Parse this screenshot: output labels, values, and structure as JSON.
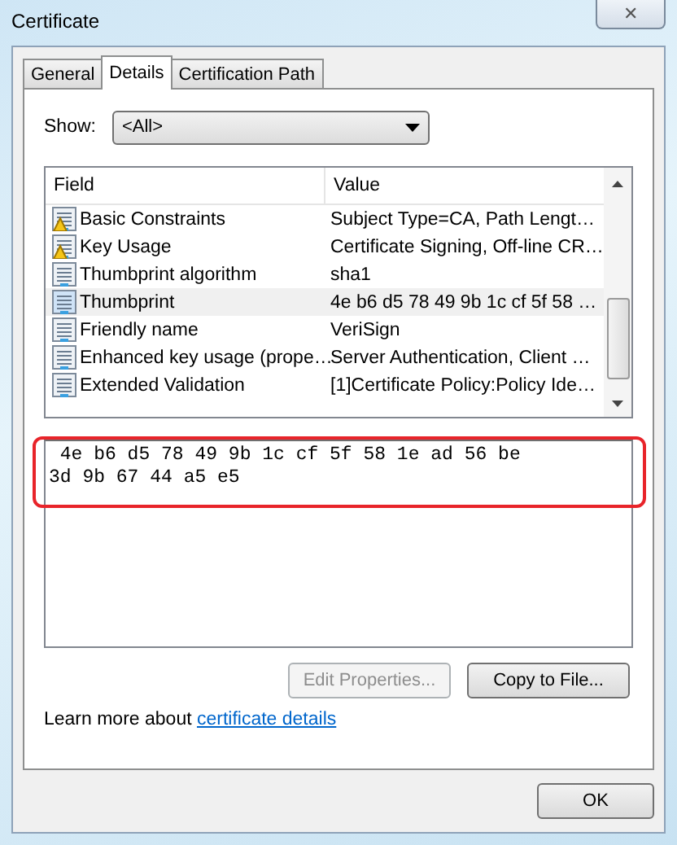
{
  "window": {
    "title": "Certificate",
    "close_symbol": "✕"
  },
  "tabs": [
    {
      "label": "General",
      "selected": false
    },
    {
      "label": "Details",
      "selected": true
    },
    {
      "label": "Certification Path",
      "selected": false
    }
  ],
  "show": {
    "label": "Show:",
    "value": "<All>"
  },
  "table": {
    "columns": [
      "Field",
      "Value"
    ],
    "rows": [
      {
        "kind": "warning",
        "field": "Basic Constraints",
        "value": "Subject Type=CA, Path Lengt…",
        "selected": false
      },
      {
        "kind": "warning",
        "field": "Key Usage",
        "value": "Certificate Signing, Off-line CR…",
        "selected": false
      },
      {
        "kind": "plain",
        "field": "Thumbprint algorithm",
        "value": "sha1",
        "selected": false
      },
      {
        "kind": "plain",
        "field": "Thumbprint",
        "value": "4e b6 d5 78 49 9b 1c cf 5f 58 …",
        "selected": true
      },
      {
        "kind": "plain",
        "field": "Friendly name",
        "value": "VeriSign",
        "selected": false
      },
      {
        "kind": "plain",
        "field": "Enhanced key usage (prope…",
        "value": "Server Authentication, Client …",
        "selected": false
      },
      {
        "kind": "plain",
        "field": "Extended Validation",
        "value": "[1]Certificate Policy:Policy Ide…",
        "selected": false
      }
    ]
  },
  "detail_text": " 4e b6 d5 78 49 9b 1c cf 5f 58 1e ad 56 be\n3d 9b 67 44 a5 e5",
  "buttons": [
    {
      "label": "Edit Properties...",
      "disabled": true
    },
    {
      "label": "Copy to File...",
      "disabled": false
    }
  ],
  "learn_more": {
    "text": "Learn more about",
    "link": "certificate details"
  },
  "ok_button": "OK"
}
